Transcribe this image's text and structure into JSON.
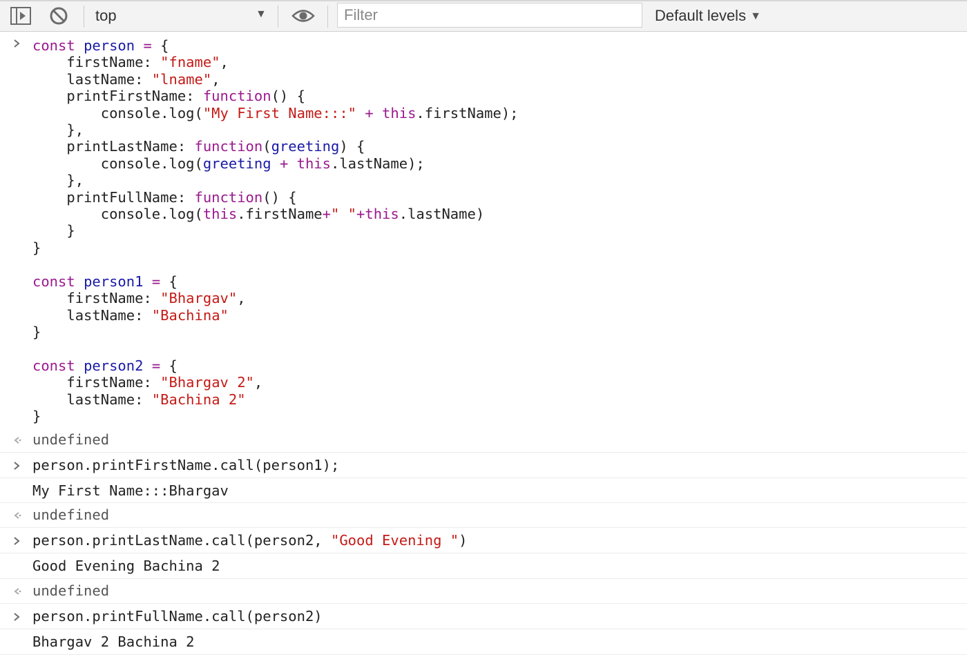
{
  "toolbar": {
    "context_label": "top",
    "filter_placeholder": "Filter",
    "levels_label": "Default levels"
  },
  "entries": {
    "input1": {
      "lines": [
        [
          "k:const",
          "t: ",
          "v:person",
          "t: ",
          "o:=",
          "t: {"
        ],
        [
          "t:    firstName: ",
          "s:\"fname\"",
          "t:,"
        ],
        [
          "t:    lastName: ",
          "s:\"lname\"",
          "t:,"
        ],
        [
          "t:    printFirstName: ",
          "k:function",
          "t:() {"
        ],
        [
          "t:        console.log(",
          "s:\"My First Name:::\"",
          "t: ",
          "o:+",
          "t: ",
          "k:this",
          "t:.firstName);"
        ],
        [
          "t:    },"
        ],
        [
          "t:    printLastName: ",
          "k:function",
          "t:(",
          "v:greeting",
          "t:) {"
        ],
        [
          "t:        console.log(",
          "v:greeting",
          "t: ",
          "o:+",
          "t: ",
          "k:this",
          "t:.lastName);"
        ],
        [
          "t:    },"
        ],
        [
          "t:    printFullName: ",
          "k:function",
          "t:() {"
        ],
        [
          "t:        console.log(",
          "k:this",
          "t:.firstName",
          "o:+",
          "s:\" \"",
          "o:+",
          "k:this",
          "t:.lastName)"
        ],
        [
          "t:    }"
        ],
        [
          "t:}"
        ],
        [
          "t:"
        ],
        [
          "k:const",
          "t: ",
          "v:person1",
          "t: ",
          "o:=",
          "t: {"
        ],
        [
          "t:    firstName: ",
          "s:\"Bhargav\"",
          "t:,"
        ],
        [
          "t:    lastName: ",
          "s:\"Bachina\""
        ],
        [
          "t:}"
        ],
        [
          "t:"
        ],
        [
          "k:const",
          "t: ",
          "v:person2",
          "t: ",
          "o:=",
          "t: {"
        ],
        [
          "t:    firstName: ",
          "s:\"Bhargav 2\"",
          "t:,"
        ],
        [
          "t:    lastName: ",
          "s:\"Bachina 2\""
        ],
        [
          "t:}"
        ]
      ]
    },
    "result1": "undefined",
    "input2": [
      [
        "t:person.printFirstName.call(person1);"
      ]
    ],
    "output2": "My First Name:::Bhargav",
    "result2": "undefined",
    "input3": [
      [
        "t:person.printLastName.call(person2, ",
        "s:\"Good Evening \"",
        "t:)"
      ]
    ],
    "output3": "Good Evening Bachina 2",
    "result3": "undefined",
    "input4": [
      [
        "t:person.printFullName.call(person2)"
      ]
    ],
    "output4": "Bhargav 2 Bachina 2"
  }
}
